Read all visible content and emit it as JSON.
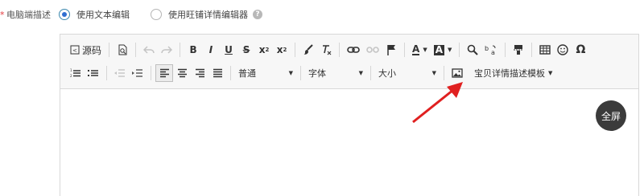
{
  "field": {
    "required_mark": "*",
    "label": "电脑端描述",
    "options": [
      {
        "label": "使用文本编辑",
        "selected": true
      },
      {
        "label": "使用旺铺详情编辑器",
        "selected": false
      }
    ],
    "help_icon": "question-circle-icon"
  },
  "toolbar": {
    "source_label": "源码",
    "bold": "B",
    "italic": "I",
    "underline": "U",
    "strike": "S",
    "subscript": "x",
    "subscript_mark": "2",
    "superscript": "x",
    "superscript_mark": "2",
    "font_color_label": "A",
    "bg_color_label": "A",
    "omega": "Ω",
    "paragraph_select": "普通",
    "font_select": "字体",
    "size_select": "大小",
    "template_menu": "宝贝详情描述模板"
  },
  "fullscreen_label": "全屏",
  "colors": {
    "accent": "#2f6fd0",
    "arrow": "#e02020",
    "fullscreen_bg": "#3b3b3b",
    "required": "#e4393c"
  }
}
